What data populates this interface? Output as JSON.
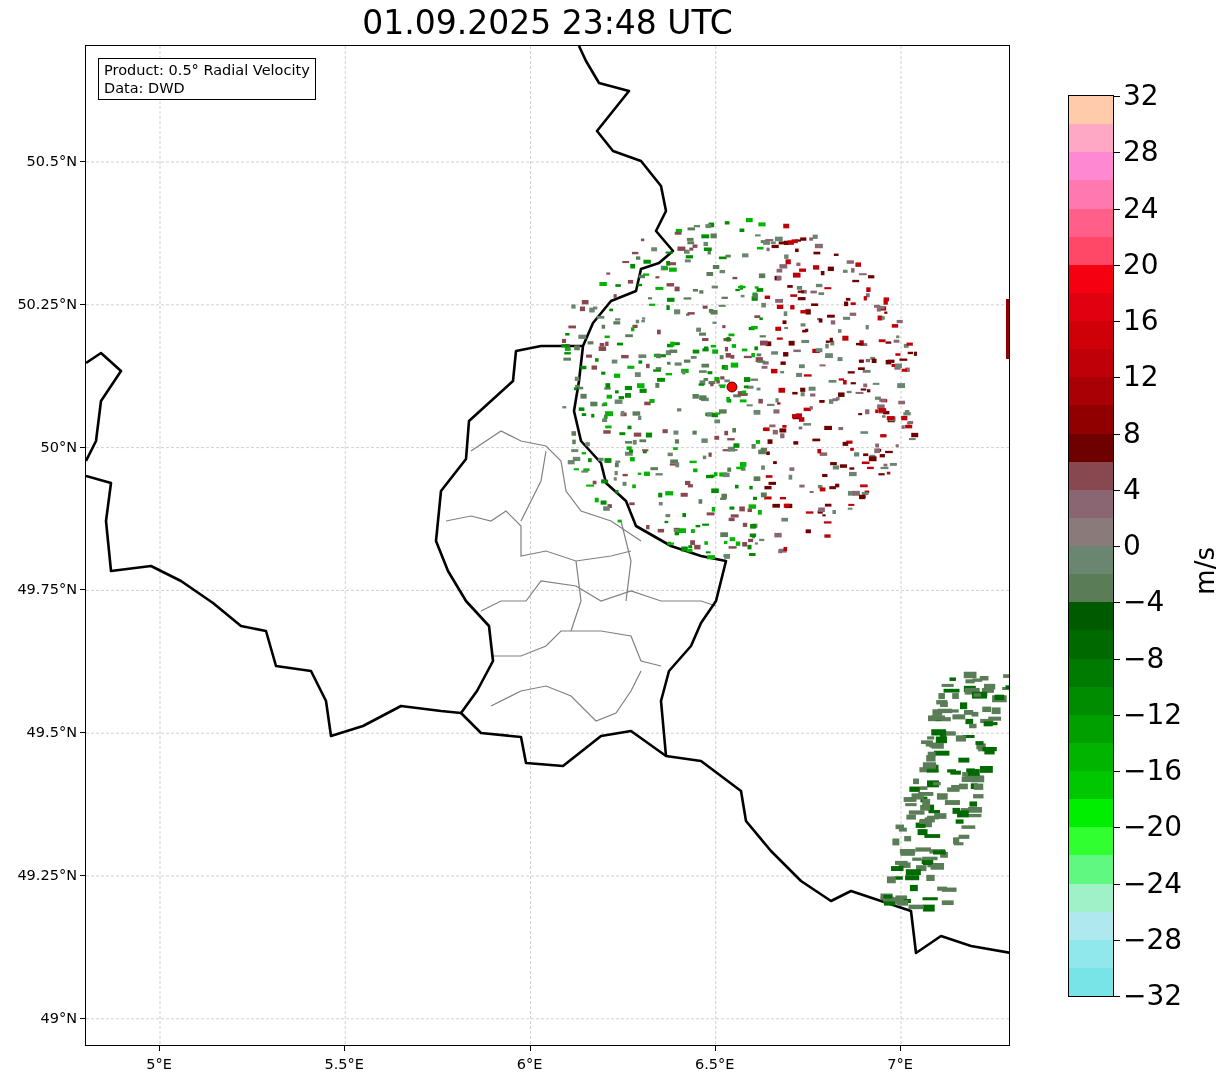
{
  "title": "01.09.2025 23:48 UTC",
  "legend": {
    "lines": [
      "Product: 0.5° Radial Velocity",
      "Data: DWD"
    ]
  },
  "map": {
    "lat_ticks": [
      "50.5°N",
      "50.25°N",
      "50°N",
      "49.75°N",
      "49.5°N",
      "49.25°N",
      "49°N"
    ],
    "lon_ticks": [
      "5°E",
      "5.5°E",
      "6°E",
      "6.5°E",
      "7°E"
    ]
  },
  "colorbar": {
    "label": "m/s",
    "ticks": [
      "32",
      "28",
      "24",
      "20",
      "16",
      "12",
      "8",
      "4",
      "0",
      "−4",
      "−8",
      "−12",
      "−16",
      "−20",
      "−24",
      "−28",
      "−32"
    ],
    "segments": [
      {
        "color": "#ffcbab"
      },
      {
        "color": "#ffa8c6"
      },
      {
        "color": "#ff88d2"
      },
      {
        "color": "#ff78b0"
      },
      {
        "color": "#ff5f88"
      },
      {
        "color": "#ff4868"
      },
      {
        "color": "#f50010"
      },
      {
        "color": "#e00010"
      },
      {
        "color": "#d00008"
      },
      {
        "color": "#c00008"
      },
      {
        "color": "#a80005"
      },
      {
        "color": "#900000"
      },
      {
        "color": "#6e0000"
      },
      {
        "color": "#884850"
      },
      {
        "color": "#8a6672"
      },
      {
        "color": "#8a7a7a"
      },
      {
        "color": "#6b8670"
      },
      {
        "color": "#5a7d58"
      },
      {
        "color": "#005a00"
      },
      {
        "color": "#006a00"
      },
      {
        "color": "#007a00"
      },
      {
        "color": "#008c00"
      },
      {
        "color": "#00a000"
      },
      {
        "color": "#00b400"
      },
      {
        "color": "#00c800"
      },
      {
        "color": "#00ee00"
      },
      {
        "color": "#30ff30"
      },
      {
        "color": "#60f880"
      },
      {
        "color": "#a0f0c8"
      },
      {
        "color": "#b0e8f0"
      },
      {
        "color": "#90e8ec"
      },
      {
        "color": "#78e4e8"
      }
    ]
  }
}
